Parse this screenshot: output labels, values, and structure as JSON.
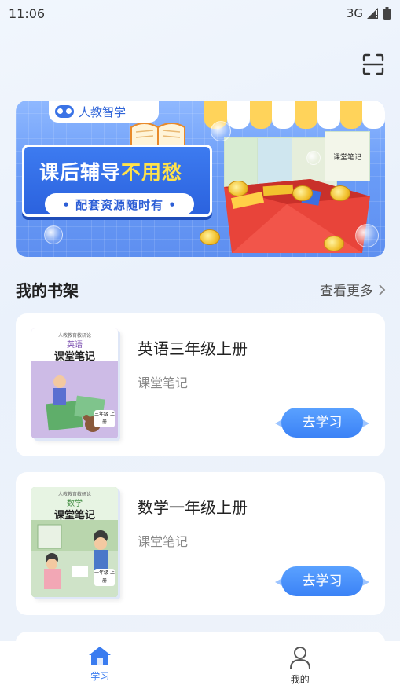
{
  "status_bar": {
    "time": "11:06",
    "network": "3G",
    "icons": [
      "signal-icon",
      "battery-icon"
    ]
  },
  "header": {
    "scan_icon": "scan-icon"
  },
  "banner": {
    "logo_text": "人教智学",
    "headline_part1": "课后辅导",
    "headline_part2": "不用愁",
    "subline": "• 配套资源随时有 •",
    "mini_book_title": "课堂笔记",
    "colors": {
      "background": "#6a9cf7",
      "accent_yellow": "#ffe24a",
      "gift_red": "#e8443a"
    }
  },
  "bookshelf": {
    "title": "我的书架",
    "see_more": "查看更多",
    "items": [
      {
        "name": "英语三年级上册",
        "type": "课堂笔记",
        "cover_small": "人教教育教研论",
        "cover_subject": "英语",
        "cover_title": "课堂笔记",
        "cover_grade": "三年级 上册",
        "action": "去学习",
        "cover_color": "#c9b6e3"
      },
      {
        "name": "数学一年级上册",
        "type": "课堂笔记",
        "cover_small": "人教教育教研论",
        "cover_subject": "数学",
        "cover_title": "课堂笔记",
        "cover_grade": "一年级 上册",
        "action": "去学习",
        "cover_color": "#b5d9b0"
      }
    ]
  },
  "tab_bar": {
    "tabs": [
      {
        "label": "学习",
        "icon": "home-icon",
        "active": true
      },
      {
        "label": "我的",
        "icon": "user-icon",
        "active": false
      }
    ],
    "active_color": "#3a7cf0"
  }
}
